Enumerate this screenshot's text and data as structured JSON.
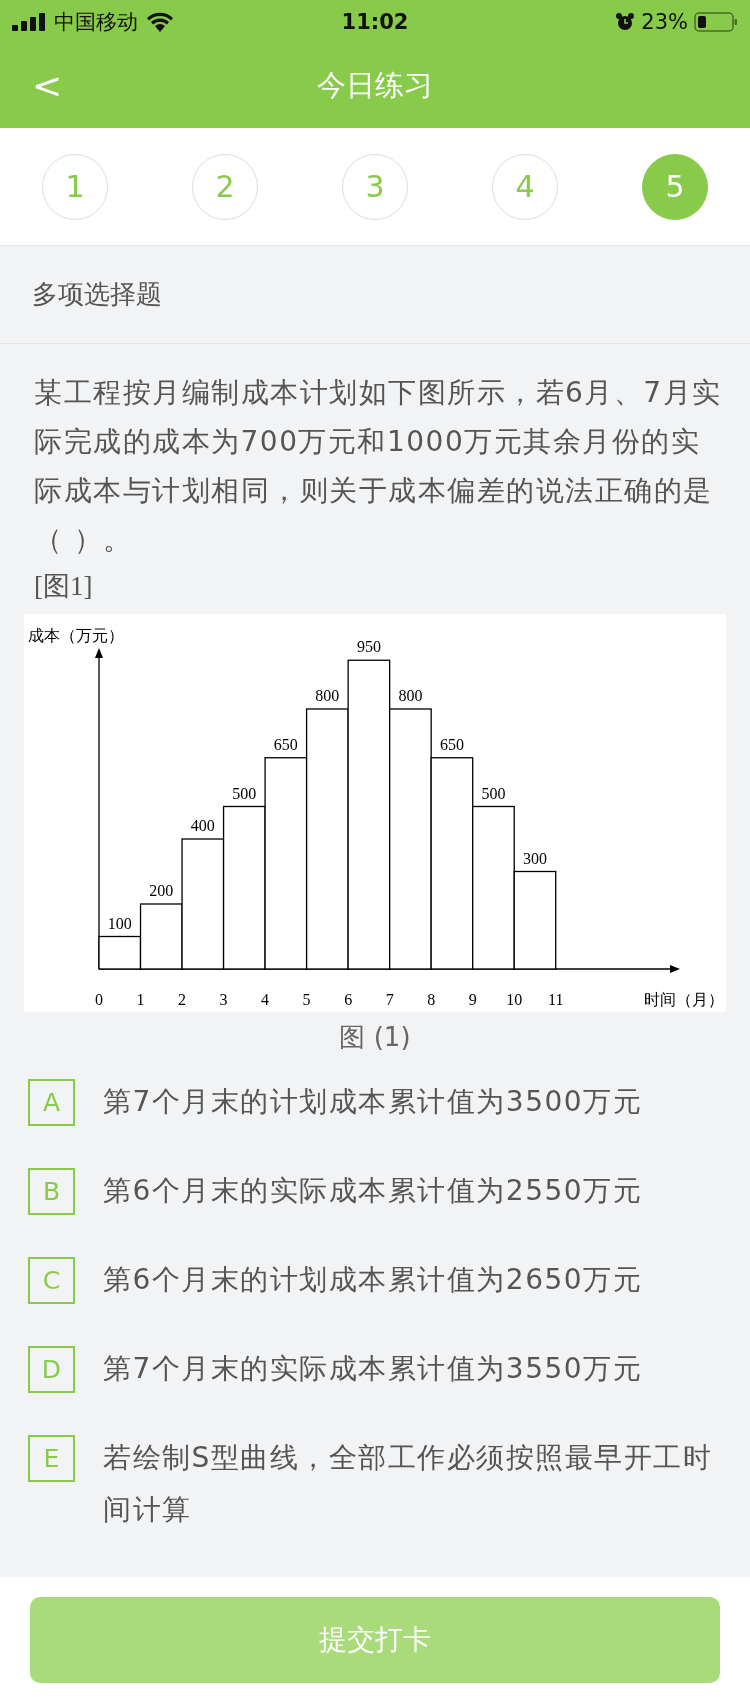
{
  "status_bar": {
    "carrier": "中国移动",
    "time": "11:02",
    "battery": "23%"
  },
  "nav": {
    "back": "<",
    "title": "今日练习"
  },
  "steps": [
    {
      "label": "1",
      "selected": false
    },
    {
      "label": "2",
      "selected": false
    },
    {
      "label": "3",
      "selected": false
    },
    {
      "label": "4",
      "selected": false
    },
    {
      "label": "5",
      "selected": true
    }
  ],
  "section": "多项选择题",
  "question": "某工程按月编制成本计划如下图所示，若6月、7月实际完成的成本为700万元和1000万元其余月份的实际成本与计划相同，则关于成本偏差的说法正确的是（ ）。",
  "figure_ref": "[图1]",
  "figure": {
    "caption": "图 (1)",
    "chart_data": {
      "type": "bar",
      "annotations": [
        {
          "text": "时间（月）"
        }
      ],
      "ylabel": "成本（万元）",
      "x": [
        0.5,
        1.5,
        2.5,
        3.5,
        4.5,
        5.5,
        6.5,
        7.5,
        8.5,
        9.5,
        10.5
      ],
      "values": [
        100,
        200,
        400,
        500,
        650,
        800,
        950,
        800,
        650,
        500,
        300
      ],
      "xticks": [
        0,
        1,
        2,
        3,
        4,
        5,
        6,
        7,
        8,
        9,
        10,
        11
      ],
      "xlim": [
        0,
        13.8
      ],
      "data_labels": true
    }
  },
  "options": [
    {
      "letter": "A",
      "text": "第7个月末的计划成本累计值为3500万元"
    },
    {
      "letter": "B",
      "text": "第6个月末的实际成本累计值为2550万元"
    },
    {
      "letter": "C",
      "text": "第6个月末的计划成本累计值为2650万元"
    },
    {
      "letter": "D",
      "text": "第7个月末的实际成本累计值为3550万元"
    },
    {
      "letter": "E",
      "text": "若绘制S型曲线，全部工作必须按照最早开工时间计算"
    }
  ],
  "submit": "提交打卡"
}
